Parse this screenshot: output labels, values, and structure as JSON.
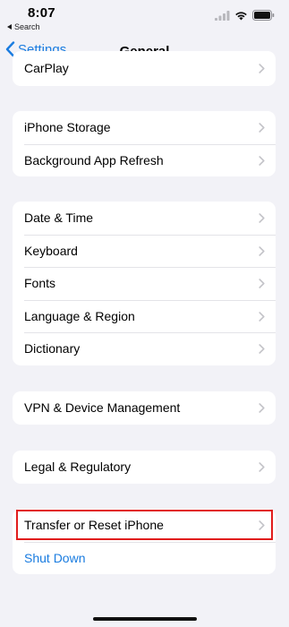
{
  "status_bar": {
    "time": "8:07",
    "back_label": "Search",
    "icons": [
      "cellular-signal-icon",
      "wifi-icon",
      "battery-icon"
    ]
  },
  "nav": {
    "back_label": "Settings",
    "title": "General"
  },
  "groups": [
    {
      "rows": [
        {
          "label": "CarPlay"
        }
      ]
    },
    {
      "rows": [
        {
          "label": "iPhone Storage"
        },
        {
          "label": "Background App Refresh"
        }
      ]
    },
    {
      "rows": [
        {
          "label": "Date & Time"
        },
        {
          "label": "Keyboard"
        },
        {
          "label": "Fonts"
        },
        {
          "label": "Language & Region"
        },
        {
          "label": "Dictionary"
        }
      ]
    },
    {
      "rows": [
        {
          "label": "VPN & Device Management"
        }
      ]
    },
    {
      "rows": [
        {
          "label": "Legal & Regulatory"
        }
      ]
    },
    {
      "rows": [
        {
          "label": "Transfer or Reset iPhone"
        },
        {
          "label": "Shut Down"
        }
      ]
    }
  ],
  "colors": {
    "accent": "#1a7ce0",
    "highlight": "#e11d1d",
    "background": "#f2f2f7"
  }
}
